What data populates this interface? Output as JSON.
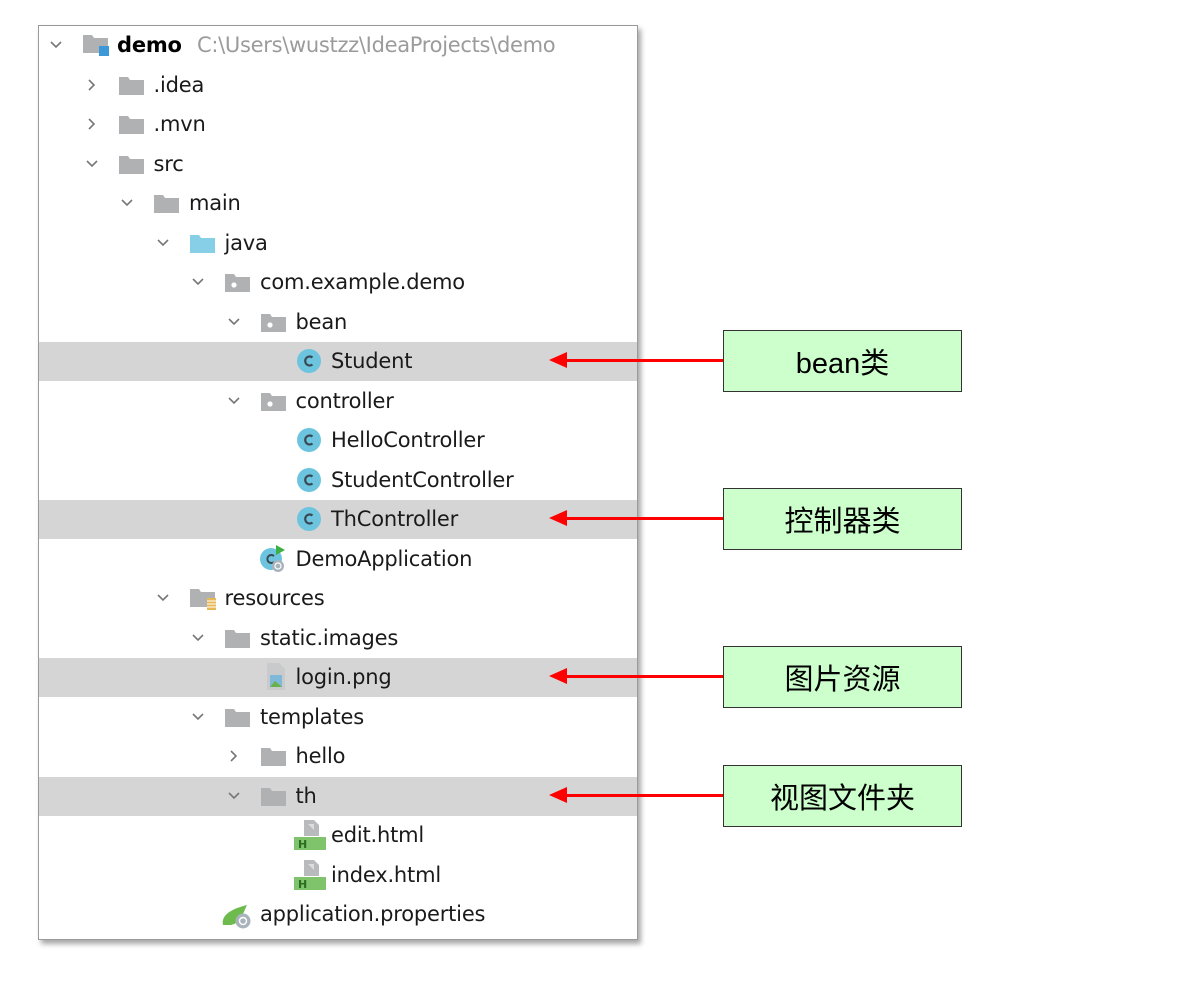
{
  "project_tree": {
    "root": {
      "name": "demo",
      "path": "C:\\Users\\wustzz\\IdeaProjects\\demo"
    },
    "items": [
      {
        "label": ".idea",
        "icon": "folder-icon",
        "expanded": false,
        "depth": 1,
        "highlighted": false
      },
      {
        "label": ".mvn",
        "icon": "folder-icon",
        "expanded": false,
        "depth": 1,
        "highlighted": false
      },
      {
        "label": "src",
        "icon": "folder-icon",
        "expanded": true,
        "depth": 1,
        "highlighted": false
      },
      {
        "label": "main",
        "icon": "folder-icon",
        "expanded": true,
        "depth": 2,
        "highlighted": false
      },
      {
        "label": "java",
        "icon": "source-folder-icon",
        "expanded": true,
        "depth": 3,
        "highlighted": false
      },
      {
        "label": "com.example.demo",
        "icon": "package-icon",
        "expanded": true,
        "depth": 4,
        "highlighted": false
      },
      {
        "label": "bean",
        "icon": "package-icon",
        "expanded": true,
        "depth": 5,
        "highlighted": false
      },
      {
        "label": "Student",
        "icon": "java-class-icon",
        "depth": 6,
        "highlighted": true
      },
      {
        "label": "controller",
        "icon": "package-icon",
        "expanded": true,
        "depth": 5,
        "highlighted": false
      },
      {
        "label": "HelloController",
        "icon": "java-class-icon",
        "depth": 6,
        "highlighted": false
      },
      {
        "label": "StudentController",
        "icon": "java-class-icon",
        "depth": 6,
        "highlighted": false
      },
      {
        "label": "ThController",
        "icon": "java-class-icon",
        "depth": 6,
        "highlighted": true
      },
      {
        "label": "DemoApplication",
        "icon": "spring-boot-app-icon",
        "depth": 5,
        "highlighted": false
      },
      {
        "label": "resources",
        "icon": "resources-folder-icon",
        "expanded": true,
        "depth": 3,
        "highlighted": false
      },
      {
        "label": "static.images",
        "icon": "folder-icon",
        "expanded": true,
        "depth": 4,
        "highlighted": false
      },
      {
        "label": "login.png",
        "icon": "image-file-icon",
        "depth": 5,
        "highlighted": true
      },
      {
        "label": "templates",
        "icon": "folder-icon",
        "expanded": true,
        "depth": 4,
        "highlighted": false
      },
      {
        "label": "hello",
        "icon": "folder-icon",
        "expanded": false,
        "depth": 5,
        "highlighted": false
      },
      {
        "label": "th",
        "icon": "folder-icon",
        "expanded": true,
        "depth": 5,
        "highlighted": true
      },
      {
        "label": "edit.html",
        "icon": "html-file-icon",
        "depth": 6,
        "highlighted": false
      },
      {
        "label": "index.html",
        "icon": "html-file-icon",
        "depth": 6,
        "highlighted": false
      },
      {
        "label": "application.properties",
        "icon": "spring-properties-icon",
        "depth": 4,
        "highlighted": false
      }
    ]
  },
  "annotations": [
    {
      "text": "bean类",
      "target": "Student"
    },
    {
      "text": "控制器类",
      "target": "ThController"
    },
    {
      "text": "图片资源",
      "target": "login.png"
    },
    {
      "text": "视图文件夹",
      "target": "th"
    }
  ],
  "colors": {
    "highlight_row": "#d5d5d5",
    "arrow": "#ff0000",
    "callout_bg": "#ccffcc",
    "folder": "#afb1b3",
    "source_folder": "#87cfe6",
    "class_icon": "#6dc4df"
  }
}
